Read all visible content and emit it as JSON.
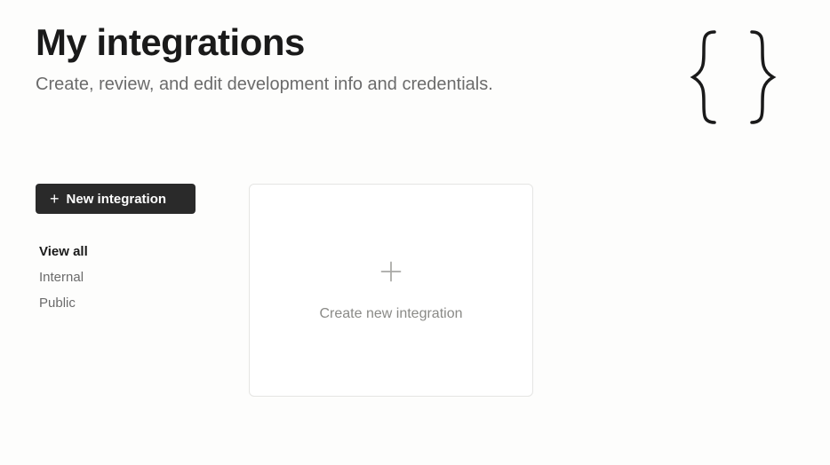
{
  "header": {
    "title": "My integrations",
    "subtitle": "Create, review, and edit development info and credentials."
  },
  "sidebar": {
    "new_button_label": "New integration",
    "filters": [
      {
        "label": "View all",
        "active": true
      },
      {
        "label": "Internal",
        "active": false
      },
      {
        "label": "Public",
        "active": false
      }
    ]
  },
  "main": {
    "create_card_label": "Create new integration"
  }
}
